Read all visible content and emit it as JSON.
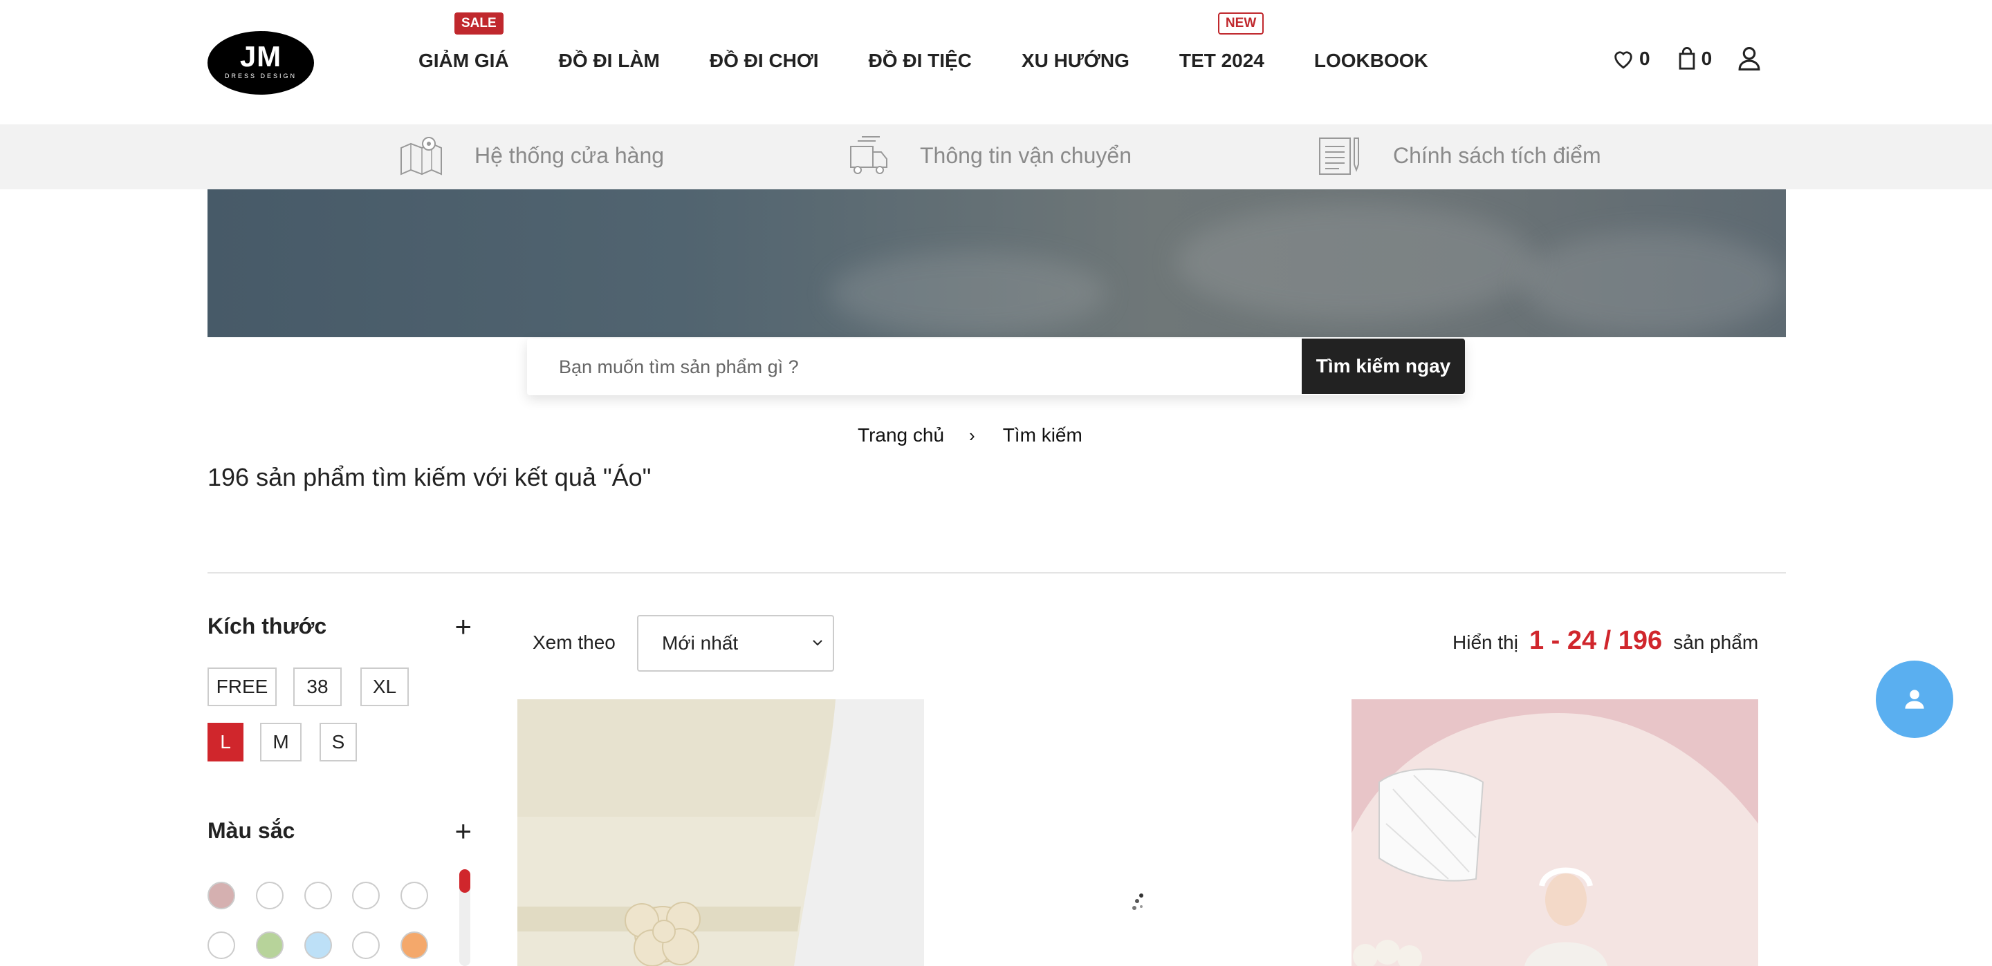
{
  "header": {
    "logo": {
      "main": "JM",
      "sub": "DRESS DESIGN"
    },
    "nav": [
      {
        "label": "GIẢM GIÁ",
        "badge": "SALE"
      },
      {
        "label": "ĐỒ ĐI LÀM"
      },
      {
        "label": "ĐỒ ĐI CHƠI"
      },
      {
        "label": "ĐỒ ĐI TIỆC"
      },
      {
        "label": "XU HƯỚNG"
      },
      {
        "label": "TET 2024",
        "badge": "NEW"
      },
      {
        "label": "LOOKBOOK"
      }
    ],
    "wishlist_count": "0",
    "cart_count": "0"
  },
  "infobar": {
    "items": [
      {
        "label": "Hệ thống cửa hàng",
        "icon": "store-map-icon"
      },
      {
        "label": "Thông tin vận chuyển",
        "icon": "delivery-truck-icon"
      },
      {
        "label": "Chính sách tích điểm",
        "icon": "policy-document-icon"
      }
    ]
  },
  "search": {
    "placeholder": "Bạn muốn tìm sản phẩm gì ?",
    "button": "Tìm kiếm ngay"
  },
  "breadcrumb": {
    "home": "Trang chủ",
    "current": "Tìm kiếm"
  },
  "result_title": "196 sản phẩm tìm kiếm với kết quả \"Áo\"",
  "filters": {
    "size": {
      "title": "Kích thước",
      "options": [
        "FREE",
        "38",
        "XL",
        "L",
        "M",
        "S"
      ],
      "selected": "L"
    },
    "color": {
      "title": "Màu sắc",
      "swatches": [
        "#d5b0b0",
        "#ffffff",
        "#ffffff",
        "#ffffff",
        "#ffffff",
        "#ffffff",
        "#b7d39a",
        "#bde0f7",
        "#ffffff",
        "#f4a86b"
      ]
    }
  },
  "toolbar": {
    "sort_label": "Xem theo",
    "sort_value": "Mới nhất",
    "count_prefix": "Hiển thị",
    "count_range": "1 - 24 / 196",
    "count_suffix": "sản phẩm"
  },
  "colors": {
    "accent": "#d0262c",
    "dark": "#222222",
    "chat": "#5aaff0"
  }
}
